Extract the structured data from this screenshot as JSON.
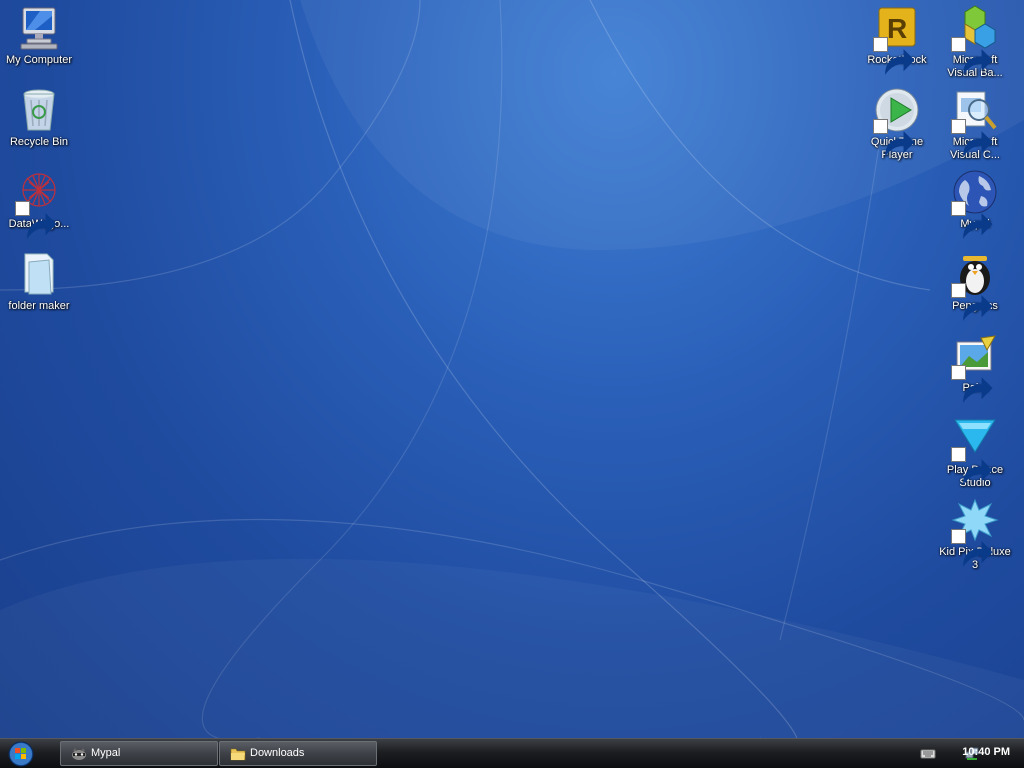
{
  "desktop": {
    "left_icons": [
      {
        "label": "My Computer",
        "icon": "computer-icon",
        "shortcut": false
      },
      {
        "label": "Recycle Bin",
        "icon": "recycle-bin-icon",
        "shortcut": false
      },
      {
        "label": "DataWago...",
        "icon": "datawagon-icon",
        "shortcut": true
      },
      {
        "label": "folder maker",
        "icon": "folder-icon",
        "shortcut": false
      }
    ],
    "right_icons_col1": [
      {
        "label": "RocketDock",
        "icon": "rocketdock-icon",
        "shortcut": true
      },
      {
        "label": "QuickTime Player",
        "icon": "quicktime-icon",
        "shortcut": true
      }
    ],
    "right_icons_col2": [
      {
        "label": "Microsoft Visual Ba...",
        "icon": "visual-basic-icon",
        "shortcut": true
      },
      {
        "label": "Microsoft Visual C...",
        "icon": "visual-c-icon",
        "shortcut": true
      },
      {
        "label": "Mypal",
        "icon": "globe-icon",
        "shortcut": true
      },
      {
        "label": "Penguins",
        "icon": "penguin-icon",
        "shortcut": true
      },
      {
        "label": "Paint",
        "icon": "paint-icon",
        "shortcut": true
      },
      {
        "label": "Play Dance Studio",
        "icon": "dance-studio-icon",
        "shortcut": true
      },
      {
        "label": "Kid Pix Deluxe 3",
        "icon": "kid-pix-icon",
        "shortcut": true
      }
    ]
  },
  "taskbar": {
    "buttons": [
      {
        "label": "Mypal",
        "icon": "mypal-raccoon-icon"
      },
      {
        "label": "Downloads",
        "icon": "folder-icon"
      }
    ],
    "tray": {
      "clock": "10:40 PM",
      "icons": [
        "keyboard-icon",
        "network-icon"
      ]
    }
  },
  "colors": {
    "desktop_bg": "#2a5fb8",
    "taskbar_bg": "#1c1e21",
    "label_text": "#ffffff"
  }
}
